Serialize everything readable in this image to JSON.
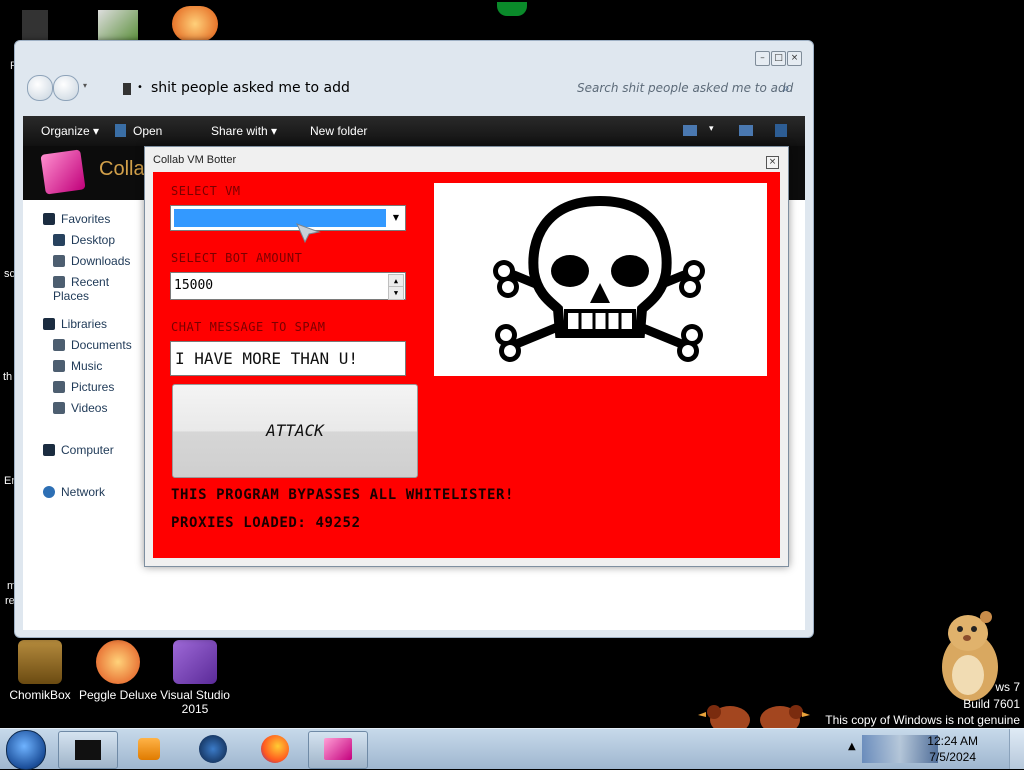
{
  "desktop": {
    "icons": [
      {
        "label": "ChomikBox"
      },
      {
        "label": "Peggle Deluxe"
      },
      {
        "label": "Visual Studio 2015"
      }
    ],
    "watermark": {
      "line1_partial": "ws 7",
      "line2_partial": "Build 7601",
      "line3": "This copy of Windows is not genuine"
    },
    "left_edge_fragments": [
      "R",
      "sc",
      "th",
      "Er",
      "m",
      "re"
    ]
  },
  "explorer": {
    "address": "shit people asked me to add",
    "search_placeholder": "Search shit people asked me to add",
    "toolbar": {
      "organize": "Organize",
      "open": "Open",
      "share_with": "Share with",
      "new_folder": "New folder"
    },
    "banner_title_partial": "Colla",
    "nav": {
      "favorites": "Favorites",
      "desktop": "Desktop",
      "downloads": "Downloads",
      "recent_places": "Recent Places",
      "libraries": "Libraries",
      "documents": "Documents",
      "music": "Music",
      "pictures": "Pictures",
      "videos": "Videos",
      "computer": "Computer",
      "network": "Network"
    }
  },
  "dialog": {
    "title": "Collab VM Botter",
    "select_vm_label": "SELECT VM",
    "select_vm_value": "",
    "bot_amount_label": "SELECT BOT AMOUNT",
    "bot_amount_value": "15000",
    "chat_label": "CHAT MESSAGE TO SPAM",
    "chat_value": "I HAVE MORE THAN U!",
    "attack_button": "ATTACK",
    "bypass_text": "THIS PROGRAM BYPASSES ALL WHITELISTER!",
    "proxies_text": "PROXIES LOADED: 49252",
    "image_icon": "skull-and-crossbones-icon"
  },
  "taskbar": {
    "time": "12:24 AM",
    "date": "7/5/2024",
    "pinned_icons": [
      "terminal-icon",
      "media-player-icon",
      "globe-icon",
      "firefox-icon",
      "collab-vm-icon"
    ]
  },
  "colors": {
    "dialog_background": "#ff0000",
    "selection_blue": "#3399ff"
  }
}
